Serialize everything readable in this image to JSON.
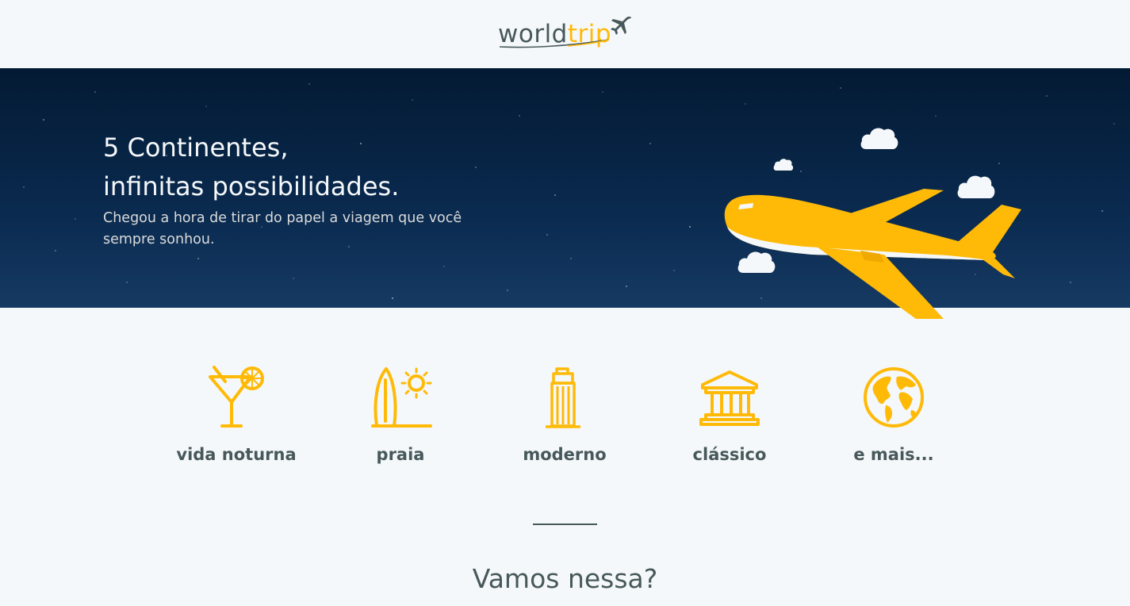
{
  "header": {
    "logo": {
      "word": "world",
      "accent": "trip"
    }
  },
  "banner": {
    "title_line1": "5 Continentes,",
    "title_line2": "infinitas possibilidades.",
    "subtitle": "Chegou a hora de tirar do papel a viagem que você sempre sonhou."
  },
  "travel_types": [
    {
      "label": "vida noturna",
      "icon": "cocktail-icon"
    },
    {
      "label": "praia",
      "icon": "surfboard-icon"
    },
    {
      "label": "moderno",
      "icon": "building-icon"
    },
    {
      "label": "clássico",
      "icon": "museum-icon"
    },
    {
      "label": "e mais...",
      "icon": "globe-icon"
    }
  ],
  "cta": {
    "text": "Vamos nessa?"
  },
  "colors": {
    "accent": "#FFBA08",
    "text": "#47585B",
    "background": "#F5F8FA",
    "banner_dark": "#031A33",
    "light": "#F5F8FA"
  }
}
